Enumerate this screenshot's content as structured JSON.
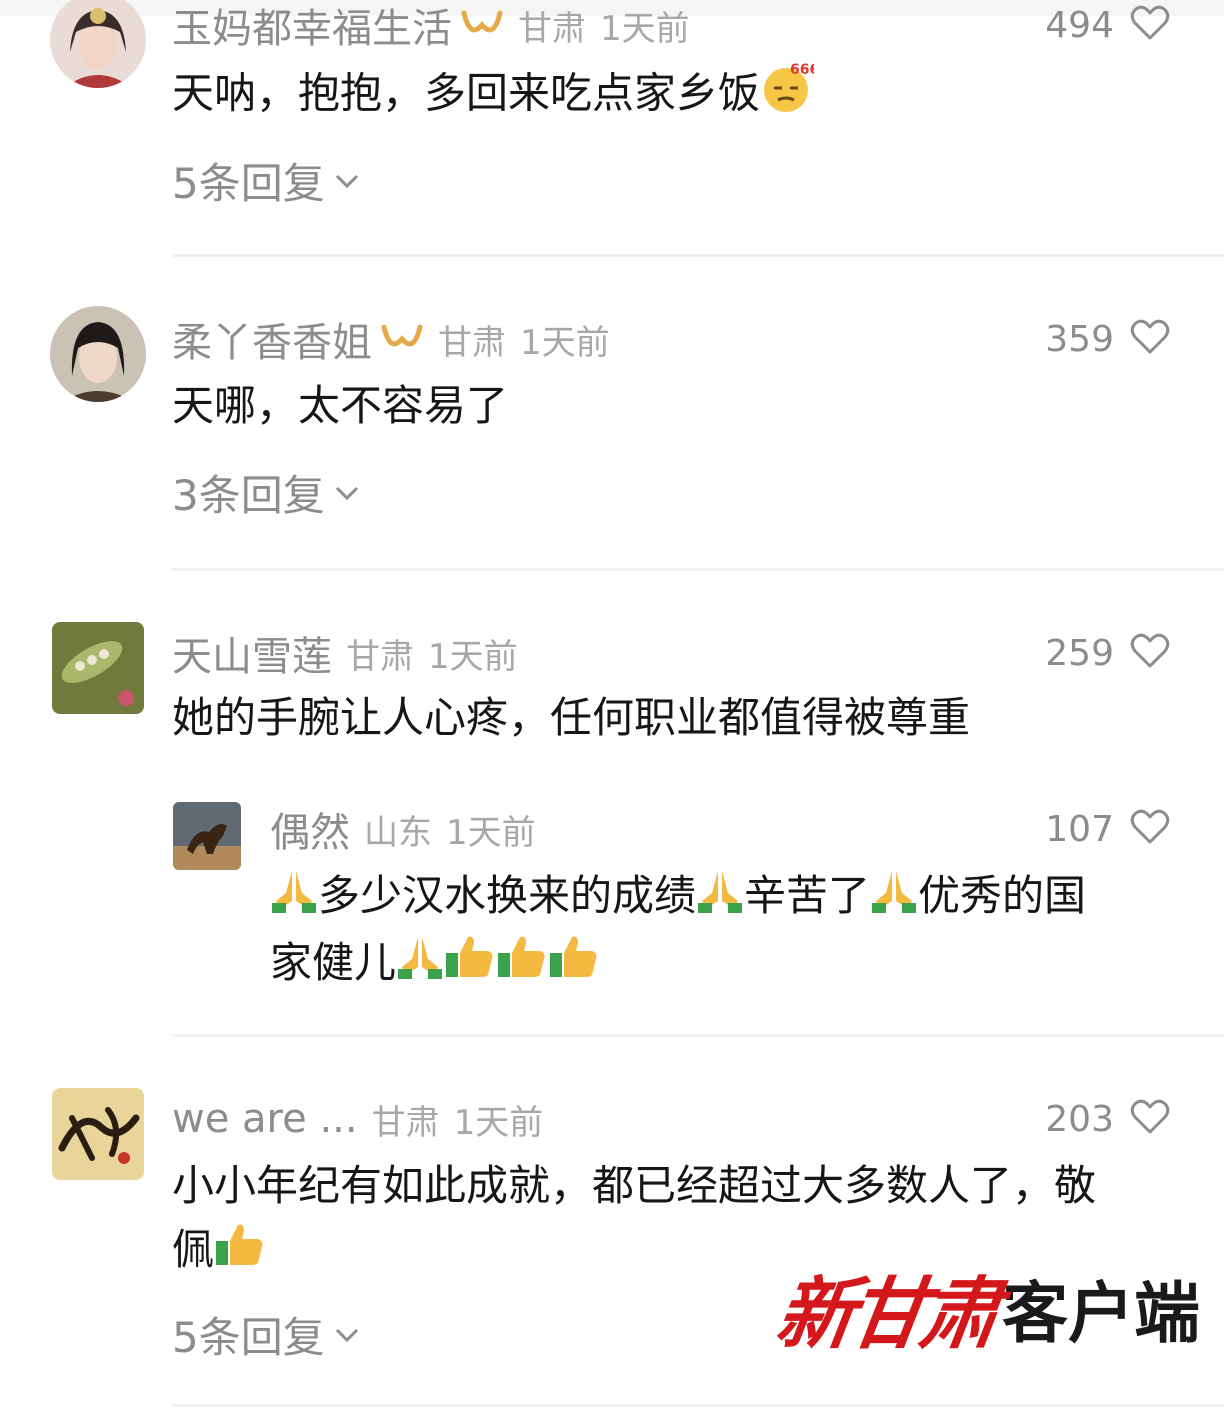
{
  "comments": [
    {
      "nickname": "玉妈都幸福生活",
      "region": "甘肃",
      "time": "1天前",
      "likes": "494",
      "content": "天呐，抱抱，多回来吃点家乡饭",
      "emoji": "666-emoji",
      "replies": "5条回复"
    },
    {
      "nickname": "柔丫香香姐",
      "region": "甘肃",
      "time": "1天前",
      "likes": "359",
      "content": "天哪，太不容易了",
      "replies": "3条回复"
    },
    {
      "nickname": "天山雪莲",
      "region": "甘肃",
      "time": "1天前",
      "likes": "259",
      "content": "她的手腕让人心疼，任何职业都值得被尊重",
      "sub_reply": {
        "nickname": "偶然",
        "region": "山东",
        "time": "1天前",
        "likes": "107",
        "line1_a": "多少汉水换来的成绩",
        "line1_b": "辛苦了",
        "line1_c": "优秀的国",
        "line2": "家健儿"
      }
    },
    {
      "nickname": "we are ...",
      "region": "甘肃",
      "time": "1天前",
      "likes": "203",
      "content_line1": "小小年纪有如此成就，都已经超过大多数人了，敬",
      "content_line2": "佩",
      "replies": "5条回复"
    }
  ],
  "watermark": {
    "brand": "新甘肃",
    "suffix": "客户端"
  },
  "colors": {
    "secondary_text": "#8c8c8c",
    "vip_badge": "#e6a94a",
    "watermark_red": "#d3171b"
  },
  "icons": {
    "like": "heart-outline-icon",
    "expand": "chevron-down-icon",
    "vip": "vip-badge-icon",
    "pray": "pray-emoji",
    "thumbs_up": "thumbs-up-emoji"
  }
}
